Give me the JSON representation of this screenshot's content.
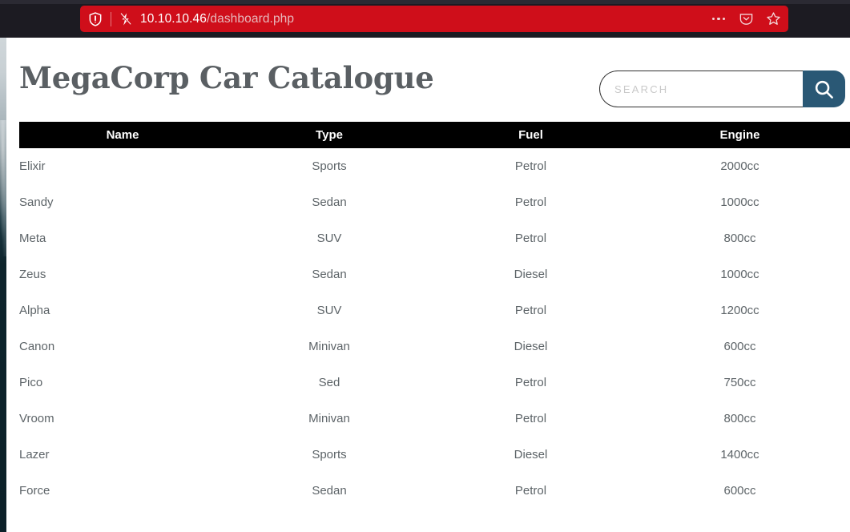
{
  "browser": {
    "url_host": "10.10.10.46",
    "url_path": "/dashboard.php",
    "shield_icon": "shield-icon",
    "connection_icon": "broken-connection-icon",
    "ellipsis_icon": "ellipsis-icon",
    "pocket_icon": "pocket-icon",
    "bookmark_icon": "bookmark-star-icon",
    "url_bar_color": "#cf0e1a",
    "chrome_color": "#1c1b22"
  },
  "page": {
    "title": "MegaCorp Car Catalogue",
    "title_color": "#5a5f63",
    "search": {
      "placeholder": "SEARCH",
      "value": "",
      "button_icon": "search-icon",
      "button_color": "#2a5875"
    },
    "table": {
      "header_background": "#000000",
      "columns": [
        "Name",
        "Type",
        "Fuel",
        "Engine"
      ],
      "rows": [
        {
          "name": "Elixir",
          "type": "Sports",
          "fuel": "Petrol",
          "engine": "2000cc"
        },
        {
          "name": "Sandy",
          "type": "Sedan",
          "fuel": "Petrol",
          "engine": "1000cc"
        },
        {
          "name": "Meta",
          "type": "SUV",
          "fuel": "Petrol",
          "engine": "800cc"
        },
        {
          "name": "Zeus",
          "type": "Sedan",
          "fuel": "Diesel",
          "engine": "1000cc"
        },
        {
          "name": "Alpha",
          "type": "SUV",
          "fuel": "Petrol",
          "engine": "1200cc"
        },
        {
          "name": "Canon",
          "type": "Minivan",
          "fuel": "Diesel",
          "engine": "600cc"
        },
        {
          "name": "Pico",
          "type": "Sed",
          "fuel": "Petrol",
          "engine": "750cc"
        },
        {
          "name": "Vroom",
          "type": "Minivan",
          "fuel": "Petrol",
          "engine": "800cc"
        },
        {
          "name": "Lazer",
          "type": "Sports",
          "fuel": "Diesel",
          "engine": "1400cc"
        },
        {
          "name": "Force",
          "type": "Sedan",
          "fuel": "Petrol",
          "engine": "600cc"
        }
      ]
    }
  }
}
